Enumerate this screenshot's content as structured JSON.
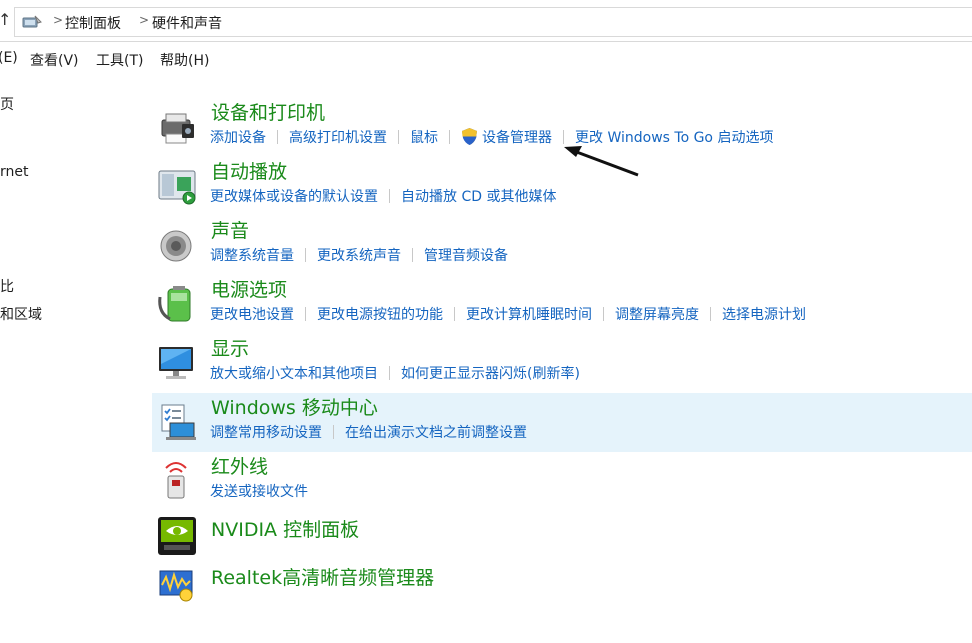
{
  "address": {
    "up_glyph": "↑",
    "breadcrumb": [
      "控制面板",
      "硬件和声音"
    ]
  },
  "menu": [
    "(E)",
    "查看(V)",
    "工具(T)",
    "帮助(H)"
  ],
  "left_pane": [
    "页",
    "rnet",
    "比",
    "和区域"
  ],
  "categories": [
    {
      "title": "设备和打印机",
      "icon": "printer-icon",
      "links": [
        "添加设备",
        "高级打印机设置",
        "鼠标",
        "设备管理器",
        "更改 Windows To Go 启动选项"
      ]
    },
    {
      "title": "自动播放",
      "icon": "autoplay-icon",
      "links": [
        "更改媒体或设备的默认设置",
        "自动播放 CD 或其他媒体"
      ]
    },
    {
      "title": "声音",
      "icon": "speaker-icon",
      "links": [
        "调整系统音量",
        "更改系统声音",
        "管理音频设备"
      ]
    },
    {
      "title": "电源选项",
      "icon": "battery-icon",
      "links": [
        "更改电池设置",
        "更改电源按钮的功能",
        "更改计算机睡眠时间",
        "调整屏幕亮度",
        "选择电源计划"
      ]
    },
    {
      "title": "显示",
      "icon": "monitor-icon",
      "links": [
        "放大或缩小文本和其他项目",
        "如何更正显示器闪烁(刷新率)"
      ]
    },
    {
      "title": "Windows 移动中心",
      "icon": "mobility-center-icon",
      "links": [
        "调整常用移动设置",
        "在给出演示文档之前调整设置"
      ]
    },
    {
      "title": "红外线",
      "icon": "infrared-icon",
      "links": [
        "发送或接收文件"
      ]
    },
    {
      "title": "NVIDIA 控制面板",
      "icon": "nvidia-icon",
      "links": []
    },
    {
      "title": "Realtek高清晰音频管理器",
      "icon": "realtek-audio-icon",
      "links": []
    }
  ],
  "colors": {
    "title_green": "#1a8a1a",
    "link_blue": "#1565c0",
    "highlight_bg": "#e5f3fb"
  }
}
